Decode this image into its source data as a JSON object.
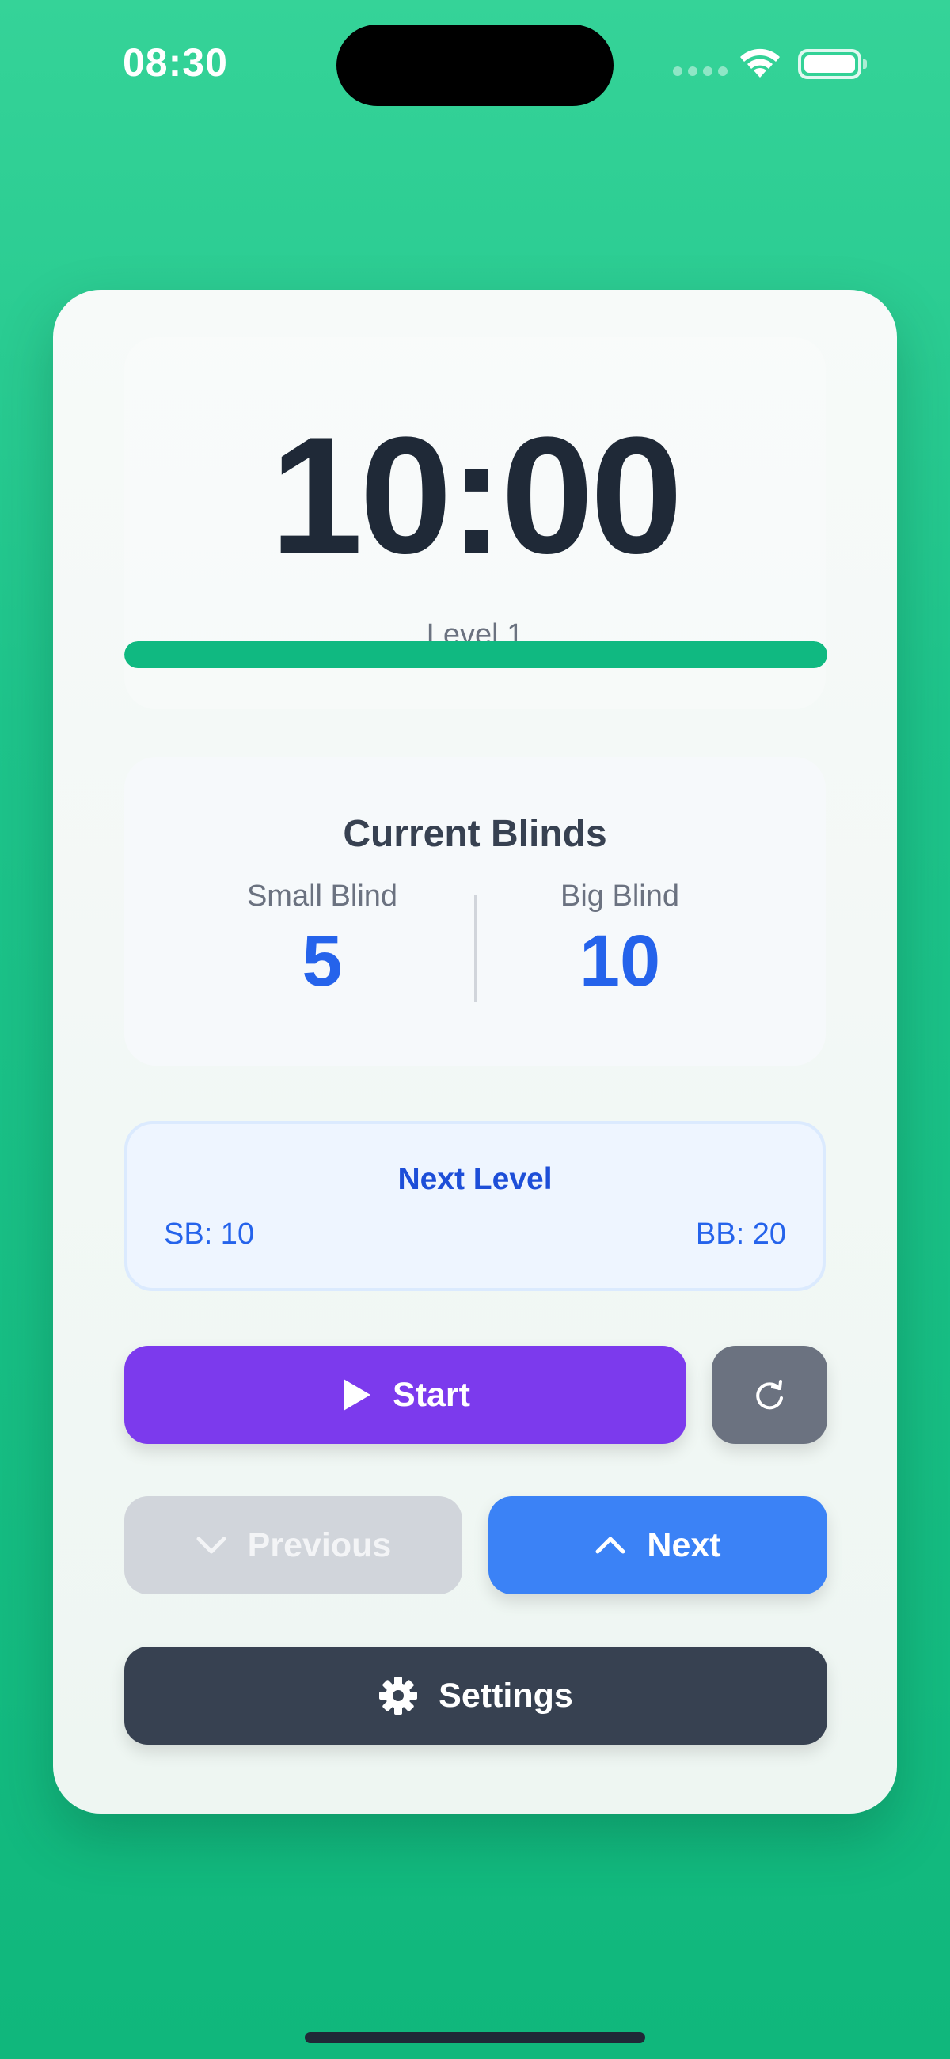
{
  "status_bar": {
    "time": "08:30"
  },
  "timer": {
    "display": "10:00",
    "level_label": "Level 1",
    "progress_fraction": 1.0
  },
  "blinds": {
    "title": "Current Blinds",
    "small_label": "Small Blind",
    "small_value": "5",
    "big_label": "Big Blind",
    "big_value": "10"
  },
  "next_level": {
    "title": "Next Level",
    "sb": "SB: 10",
    "bb": "BB: 20"
  },
  "buttons": {
    "start": "Start",
    "previous": "Previous",
    "next": "Next",
    "settings": "Settings"
  },
  "icons": {
    "start": "play-icon",
    "reset": "refresh-icon",
    "previous": "chevron-down-icon",
    "next": "chevron-up-icon",
    "settings": "gear-icon"
  },
  "colors": {
    "background": "#1ec48b",
    "timer_text": "#1f2937",
    "progress": "#10b981",
    "blind_value": "#2563eb",
    "start": "#7c3aed",
    "reset": "#6b7280",
    "previous_disabled": "#d1d5db",
    "next": "#3b82f6",
    "settings": "#374151"
  }
}
